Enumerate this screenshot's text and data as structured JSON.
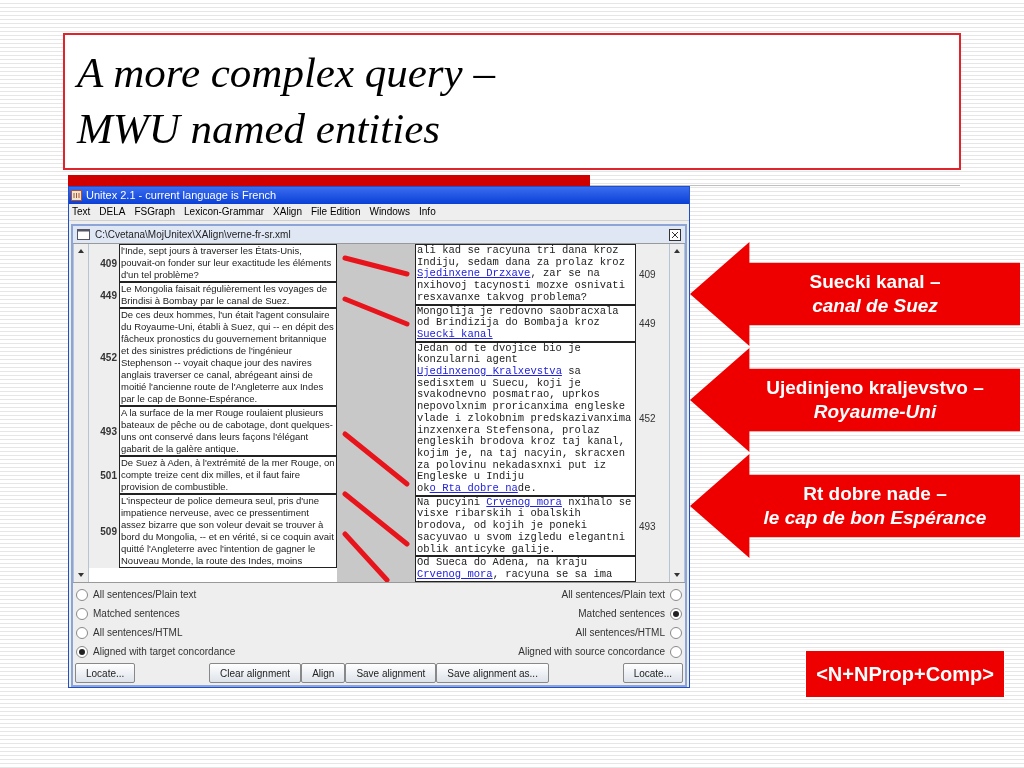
{
  "slide": {
    "title_lines": [
      "A more complex query –",
      "MWU named entities"
    ]
  },
  "window": {
    "title": "Unitex 2.1 - current language is French",
    "menu": [
      "Text",
      "DELA",
      "FSGraph",
      "Lexicon-Grammar",
      "XAlign",
      "File Edition",
      "Windows",
      "Info"
    ],
    "document": {
      "title": "C:\\Cvetana\\MojUnitex\\XAlign\\verne-fr-sr.xml",
      "source_rows": [
        {
          "number": "409",
          "text": "l'Inde, sept jours à traverser les États-Unis, pouvait-on fonder sur leur exactitude les éléments d'un tel problème?"
        },
        {
          "number": "449",
          "text": "Le Mongolia faisait régulièrement les voyages de Brindisi à Bombay par le canal de Suez."
        },
        {
          "number": "452",
          "text": "De ces deux hommes, l'un était l'agent consulaire du Royaume-Uni, établi à Suez, qui -- en dépit des fâcheux pronostics du gouvernement britannique et des sinistres prédictions de l'ingénieur Stephenson -- voyait chaque jour des navires anglais traverser ce canal, abrégeant ainsi de moitié l'ancienne route de l'Angleterre aux Indes par le cap de Bonne-Espérance."
        },
        {
          "number": "493",
          "text": "A la surface de la mer Rouge roulaient plusieurs bateaux de pêche ou de cabotage, dont quelques-uns ont conservé dans leurs façons l'élégant gabarit de la galère antique."
        },
        {
          "number": "501",
          "text": " De Suez à Aden, à l'extrémité de la mer Rouge, on compte treize cent dix milles, et il faut faire provision de combustible."
        },
        {
          "number": "509",
          "text": "L'inspecteur de police demeura seul, pris d'une impatience nerveuse, avec ce pressentiment assez bizarre que son voleur devait se trouver à bord du Mongolia, -- et en vérité, si ce coquin avait quitté l'Angleterre avec l'intention de gagner le Nouveau Monde, la route des Indes, moins"
        }
      ],
      "target_rows": [
        {
          "number": "409",
          "segments": [
            {
              "text": "ali kad se racyuna tri dana kroz Indiju, sedam dana za prolaz kroz ",
              "link": false
            },
            {
              "text": "Sjedinxene Drzxave",
              "link": true
            },
            {
              "text": ", zar se na nxihovoj tacynosti mozxe osnivati resxavanxe takvog problema?",
              "link": false
            }
          ]
        },
        {
          "number": "449",
          "segments": [
            {
              "text": "Mongolija je redovno saobracxala od Brindizija do Bombaja kroz ",
              "link": false
            },
            {
              "text": "Suecki kanal",
              "link": true
            }
          ]
        },
        {
          "number": "452",
          "segments": [
            {
              "text": "Jedan od te dvojice bio je konzularni agent ",
              "link": false
            },
            {
              "text": "Ujedinxenog ",
              "link": true
            },
            {
              "text": "Kralxevstva",
              "link": true
            },
            {
              "text": " sa sedisxtem u Suecu, koji je svakodnevno posmatrao, uprkos nepovolxnim proricanxima engleske vlade i zlokobnim predskazivanxima inzxenxera Stefensona, prolaz engleskih brodova kroz taj kanal, kojim je, na taj nacyin, skracxen za polovinu nekadasxnxi put iz Engleske u Indiju ok",
              "link": false
            },
            {
              "text": "o Rta dobre na",
              "link": true
            },
            {
              "text": "de.",
              "link": false
            }
          ]
        },
        {
          "number": "493",
          "segments": [
            {
              "text": "Na pucyini ",
              "link": false
            },
            {
              "text": "Crvenog mora",
              "link": true
            },
            {
              "text": " nxihalo se visxe ribarskih i obalskih brodova, od kojih je poneki sacyuvao u svom izgledu elegantni oblik anticyke galije.",
              "link": false
            }
          ]
        },
        {
          "segments": [
            {
              "text": "Od Sueca do Adena, na kraju ",
              "link": false
            },
            {
              "text": "Crvenog mora",
              "link": true
            },
            {
              "text": ", racyuna se sa ima",
              "link": false
            }
          ]
        }
      ],
      "source_options": [
        {
          "label": "All sentences/Plain text",
          "selected": false
        },
        {
          "label": "Matched sentences",
          "selected": false
        },
        {
          "label": "All sentences/HTML",
          "selected": false
        },
        {
          "label": "Aligned with target concordance",
          "selected": true
        }
      ],
      "target_options": [
        {
          "label": "All sentences/Plain text",
          "selected": false
        },
        {
          "label": "Matched sentences",
          "selected": true
        },
        {
          "label": "All sentences/HTML",
          "selected": false
        },
        {
          "label": "Aligned with source concordance",
          "selected": false
        }
      ],
      "buttons": [
        "Locate...",
        "Clear alignment",
        "Align",
        "Save alignment",
        "Save alignment as...",
        "Locate..."
      ]
    }
  },
  "callouts": [
    {
      "lines": [
        {
          "text": "Suecki kanal –",
          "italic": false
        },
        {
          "text": "canal de Suez",
          "italic": true
        }
      ]
    },
    {
      "lines": [
        {
          "text": "Ujedinjeno kraljevstvo –",
          "italic": false
        },
        {
          "text": "Royaume-Uni",
          "italic": true
        }
      ]
    },
    {
      "lines": [
        {
          "text": "Rt dobre nade –",
          "italic": false
        },
        {
          "text": "le cap de bon Espérance",
          "italic": true
        }
      ]
    }
  ],
  "tag": "<N+NProp+Comp>"
}
